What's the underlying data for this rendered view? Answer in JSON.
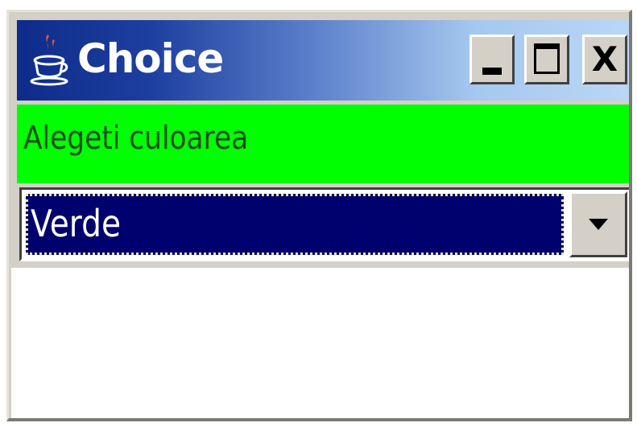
{
  "window": {
    "title": "Choice",
    "icon": "java-coffee-cup-icon",
    "controls": {
      "minimize_icon": "minimize-icon",
      "maximize_icon": "maximize-icon",
      "close_label": "X"
    }
  },
  "label": {
    "text": "Alegeti culoarea",
    "background_color": "#00ff00"
  },
  "choice": {
    "selected_value": "Verde",
    "selection_color": "#00006e",
    "dropdown_icon": "chevron-down-icon"
  }
}
